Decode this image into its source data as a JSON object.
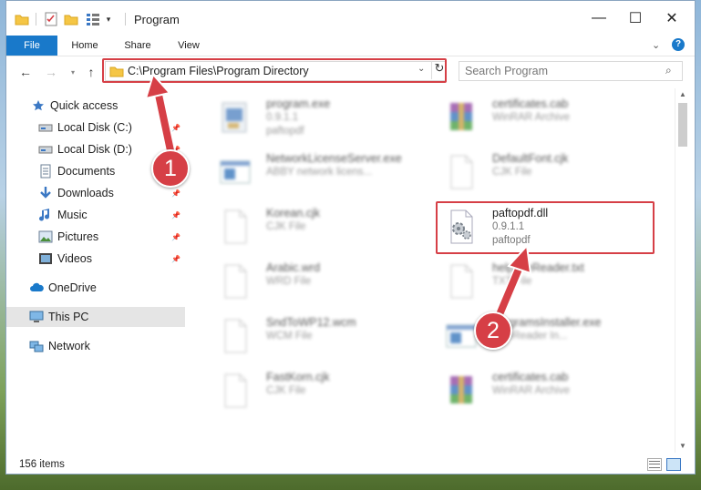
{
  "window": {
    "title": "Program",
    "minimize_glyph": "—",
    "maximize_glyph": "☐",
    "close_glyph": "✕"
  },
  "ribbon": {
    "tabs": [
      {
        "label": "File"
      },
      {
        "label": "Home"
      },
      {
        "label": "Share"
      },
      {
        "label": "View"
      }
    ],
    "help_glyph": "?"
  },
  "navigation": {
    "address": "C:\\Program Files\\Program Directory",
    "search_placeholder": "Search Program"
  },
  "sidebar": {
    "items": [
      {
        "label": "Quick access",
        "icon": "star-icon",
        "pinned": false
      },
      {
        "label": "Local Disk (C:)",
        "icon": "drive-icon",
        "pinned": true
      },
      {
        "label": "Local Disk (D:)",
        "icon": "drive-icon",
        "pinned": true
      },
      {
        "label": "Documents",
        "icon": "documents-icon",
        "pinned": true
      },
      {
        "label": "Downloads",
        "icon": "download-icon",
        "pinned": true
      },
      {
        "label": "Music",
        "icon": "music-icon",
        "pinned": true
      },
      {
        "label": "Pictures",
        "icon": "pictures-icon",
        "pinned": true
      },
      {
        "label": "Videos",
        "icon": "videos-icon",
        "pinned": true
      },
      {
        "label": "OneDrive",
        "icon": "cloud-icon",
        "pinned": false
      },
      {
        "label": "This PC",
        "icon": "computer-icon",
        "pinned": false,
        "selected": true
      },
      {
        "label": "Network",
        "icon": "network-icon",
        "pinned": false
      }
    ]
  },
  "files": [
    {
      "name": "program.exe",
      "line2": "0.9.1.1",
      "line3": "paftopdf",
      "icon": "exe-icon",
      "blurred": true
    },
    {
      "name": "certificates.cab",
      "line2": "WinRAR Archive",
      "line3": "",
      "icon": "winrar-icon",
      "blurred": true
    },
    {
      "name": "NetworkLicenseServer.exe",
      "line2": "ABBY network licens...",
      "line3": "",
      "icon": "window-icon",
      "blurred": true
    },
    {
      "name": "DefaultFont.cjk",
      "line2": "CJK File",
      "line3": "",
      "icon": "file-icon",
      "blurred": true
    },
    {
      "name": "Korean.cjk",
      "line2": "CJK File",
      "line3": "",
      "icon": "file-icon",
      "blurred": true
    },
    {
      "name": "paftopdf.dll",
      "line2": "0.9.1.1",
      "line3": "paftopdf",
      "icon": "dll-gear-icon",
      "blurred": false,
      "highlighted": true
    },
    {
      "name": "Arabic.wrd",
      "line2": "WRD File",
      "line3": "",
      "icon": "file-icon",
      "blurred": true
    },
    {
      "name": "helpFileReader.txt",
      "line2": "TXT File",
      "line3": "",
      "icon": "file-icon",
      "blurred": true
    },
    {
      "name": "SndToWP12.wcm",
      "line2": "WCM File",
      "line3": "",
      "icon": "file-icon",
      "blurred": true
    },
    {
      "name": "programsInstaller.exe",
      "line2": "FineReader In...",
      "line3": "",
      "icon": "window-icon",
      "blurred": true
    },
    {
      "name": "FastKorn.cjk",
      "line2": "CJK File",
      "line3": "",
      "icon": "file-icon",
      "blurred": true
    },
    {
      "name": "certificates.cab",
      "line2": "WinRAR Archive",
      "line3": "",
      "icon": "winrar-icon",
      "blurred": true
    }
  ],
  "status": {
    "item_count": "156 items"
  },
  "annotations": {
    "step1": "1",
    "step2": "2",
    "color": "#d63f46"
  },
  "colors": {
    "accent": "#1979ca",
    "highlight": "#d63f46",
    "folder": "#f5c645"
  }
}
